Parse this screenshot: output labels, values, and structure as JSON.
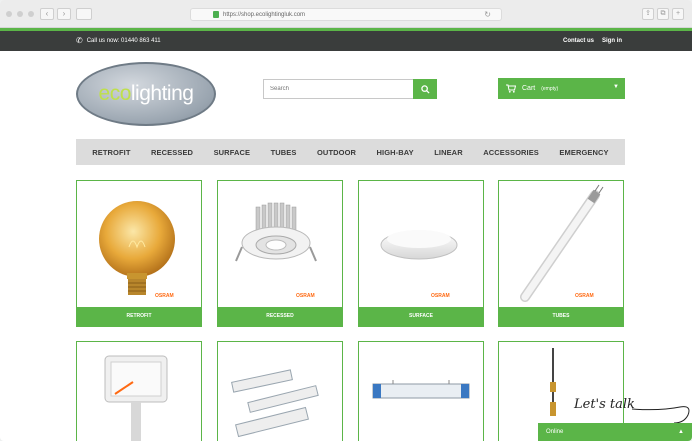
{
  "browser": {
    "url": "https://shop.ecolightingluk.com"
  },
  "topbar": {
    "phone_text": "Call us now: 01440 863 411",
    "contact_label": "Contact us",
    "signin_label": "Sign in"
  },
  "header": {
    "logo_eco": "eco",
    "logo_lighting": "lighting",
    "search_placeholder": "Search",
    "cart_label": "Cart",
    "cart_status": "(empty)"
  },
  "categories": [
    "RETROFIT",
    "RECESSED",
    "SURFACE",
    "TUBES",
    "OUTDOOR",
    "HIGH-BAY",
    "LINEAR",
    "ACCESSORIES",
    "EMERGENCY"
  ],
  "products": [
    {
      "label": "RETROFIT",
      "brand": "OSRAM"
    },
    {
      "label": "RECESSED",
      "brand": "OSRAM"
    },
    {
      "label": "SURFACE",
      "brand": "OSRAM"
    },
    {
      "label": "TUBES",
      "brand": "OSRAM"
    }
  ],
  "chat": {
    "tagline": "Let's talk",
    "bar_label": "Online"
  },
  "colors": {
    "accent": "#5bb548",
    "topbar": "#3a3d3c",
    "nav": "#dcdcdc"
  }
}
